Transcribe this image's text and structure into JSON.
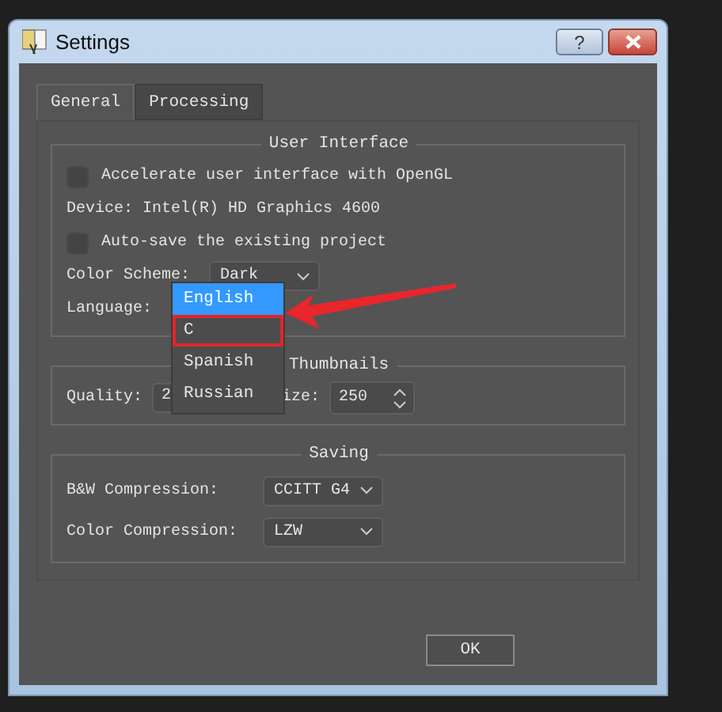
{
  "window": {
    "title": "Settings",
    "buttons": [
      {
        "kind": "help",
        "label": "?"
      },
      {
        "kind": "close"
      }
    ]
  },
  "tabs": [
    {
      "label": "General",
      "selected": true
    },
    {
      "label": "Processing",
      "selected": false
    }
  ],
  "groups": [
    {
      "title": "User Interface",
      "kind": "stack",
      "rows": [
        [
          {
            "kind": "checkbox",
            "label": "Accelerate user interface with OpenGL",
            "checked": false
          }
        ],
        [
          {
            "kind": "text",
            "text": "Device: Intel(R) HD Graphics 4600"
          }
        ],
        [
          {
            "kind": "checkbox",
            "label": "Auto-save the existing project",
            "checked": false
          }
        ],
        [
          {
            "kind": "label",
            "text": "Color Scheme:"
          },
          {
            "kind": "combo",
            "value": "Dark"
          }
        ],
        [
          {
            "kind": "label",
            "text": "Language:"
          },
          {
            "kind": "popup",
            "options": [
              {
                "label": "English",
                "selected": true,
                "marked": false
              },
              {
                "label": "C",
                "selected": false,
                "marked": true
              },
              {
                "label": "Spanish",
                "selected": false,
                "marked": false
              },
              {
                "label": "Russian",
                "selected": false,
                "marked": false
              }
            ]
          }
        ]
      ]
    },
    {
      "title": "Thumbnails",
      "kind": "inline",
      "rows": [
        [
          {
            "kind": "label",
            "text": "Quality:"
          },
          {
            "kind": "field",
            "value": "2"
          },
          {
            "kind": "label",
            "text": "ize:"
          },
          {
            "kind": "spin",
            "value": "250"
          }
        ]
      ]
    },
    {
      "title": "Saving",
      "kind": "form",
      "rows": [
        [
          {
            "kind": "label",
            "text": "B&W Compression:"
          },
          {
            "kind": "combo",
            "value": "CCITT G4"
          }
        ],
        [
          {
            "kind": "label",
            "text": "Color Compression:"
          },
          {
            "kind": "combo",
            "value": "LZW"
          }
        ]
      ]
    }
  ],
  "buttons": [
    {
      "label": "OK"
    }
  ]
}
